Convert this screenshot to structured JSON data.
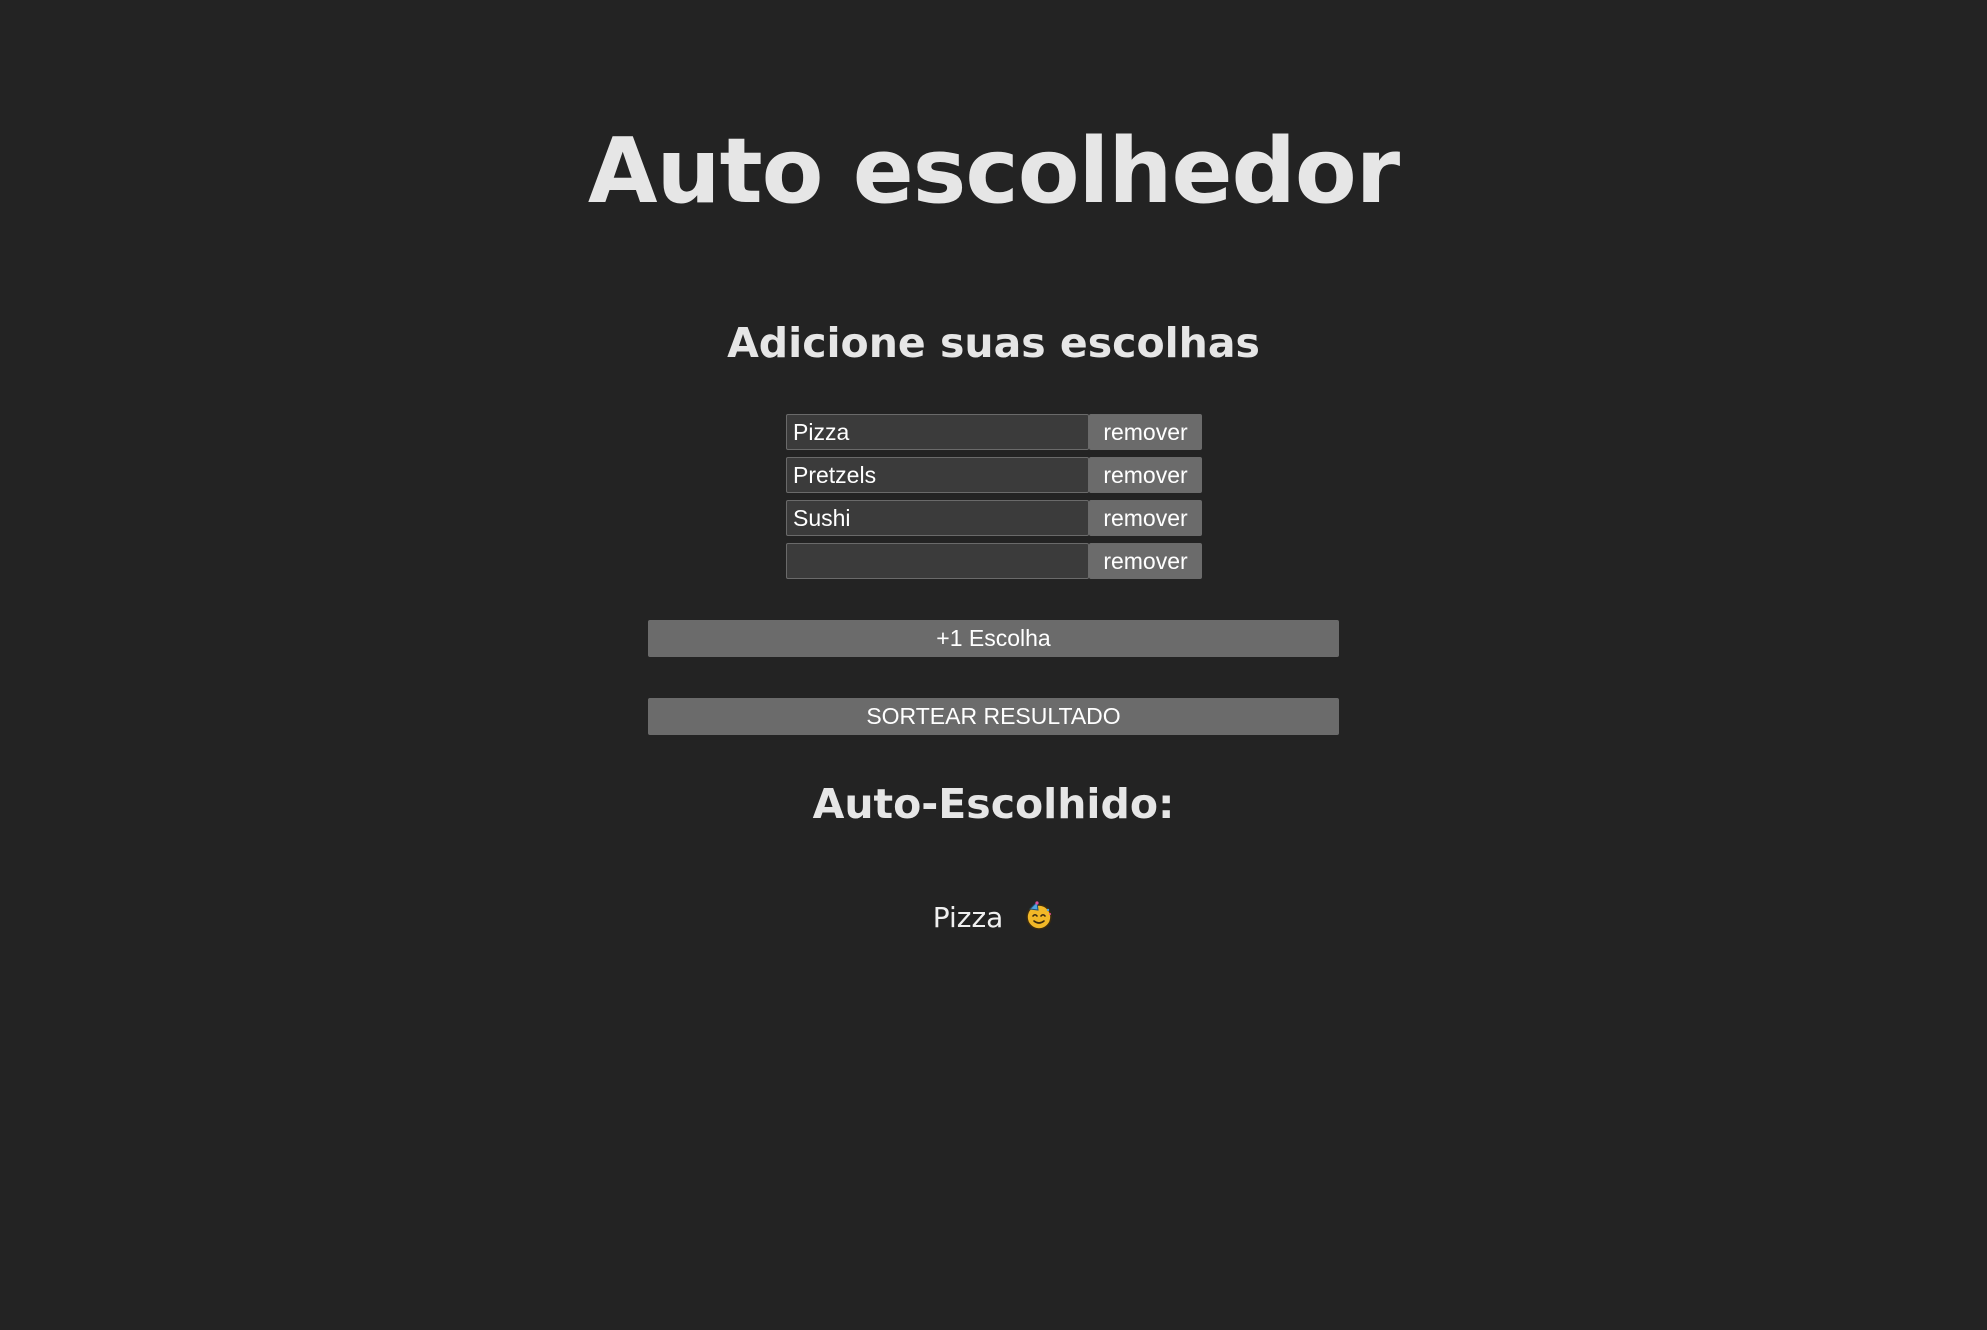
{
  "header": {
    "title": "Auto escolhedor",
    "subtitle": "Adicione suas escolhas"
  },
  "choices": [
    {
      "value": "Pizza",
      "remove_label": "remover"
    },
    {
      "value": "Pretzels",
      "remove_label": "remover"
    },
    {
      "value": "Sushi",
      "remove_label": "remover"
    },
    {
      "value": "",
      "remove_label": "remover"
    }
  ],
  "actions": {
    "add_label": "+1 Escolha",
    "draw_label": "SORTEAR RESULTADO"
  },
  "result": {
    "heading": "Auto-Escolhido:",
    "value": "Pizza",
    "emoji_icon": "party-face-icon"
  },
  "colors": {
    "background": "#232323",
    "button": "#6b6b6b",
    "input": "#3b3b3b",
    "text": "#e6e6e6"
  }
}
